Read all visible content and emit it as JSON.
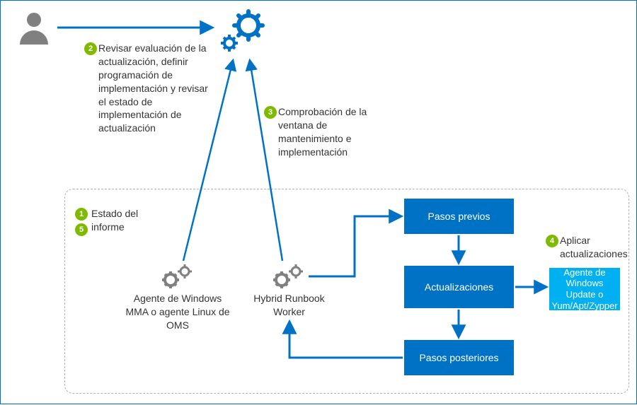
{
  "steps": {
    "s1": "Estado del informe",
    "s2": "Revisar evaluación de la actualización, definir programación de implementación y revisar el estado de implementación de actualización",
    "s3": "Comprobación de la ventana de mantenimiento e implementación",
    "s4": "Aplicar actualizaciones"
  },
  "badges": {
    "b1": "1",
    "b2": "2",
    "b3": "3",
    "b4": "4",
    "b5": "5"
  },
  "nodes": {
    "agent_mma": "Agente de Windows MMA o agente Linux de OMS",
    "hybrid_worker": "Hybrid Runbook Worker",
    "pre_steps": "Pasos previos",
    "updates": "Actualizaciones",
    "post_steps": "Pasos posteriores",
    "update_agent": "Agente de Windows Update o Yum/Apt/Zypper"
  },
  "colors": {
    "primary_blue": "#0072c6",
    "light_blue": "#00b0f0",
    "green": "#7fba00",
    "gray": "#808080"
  }
}
